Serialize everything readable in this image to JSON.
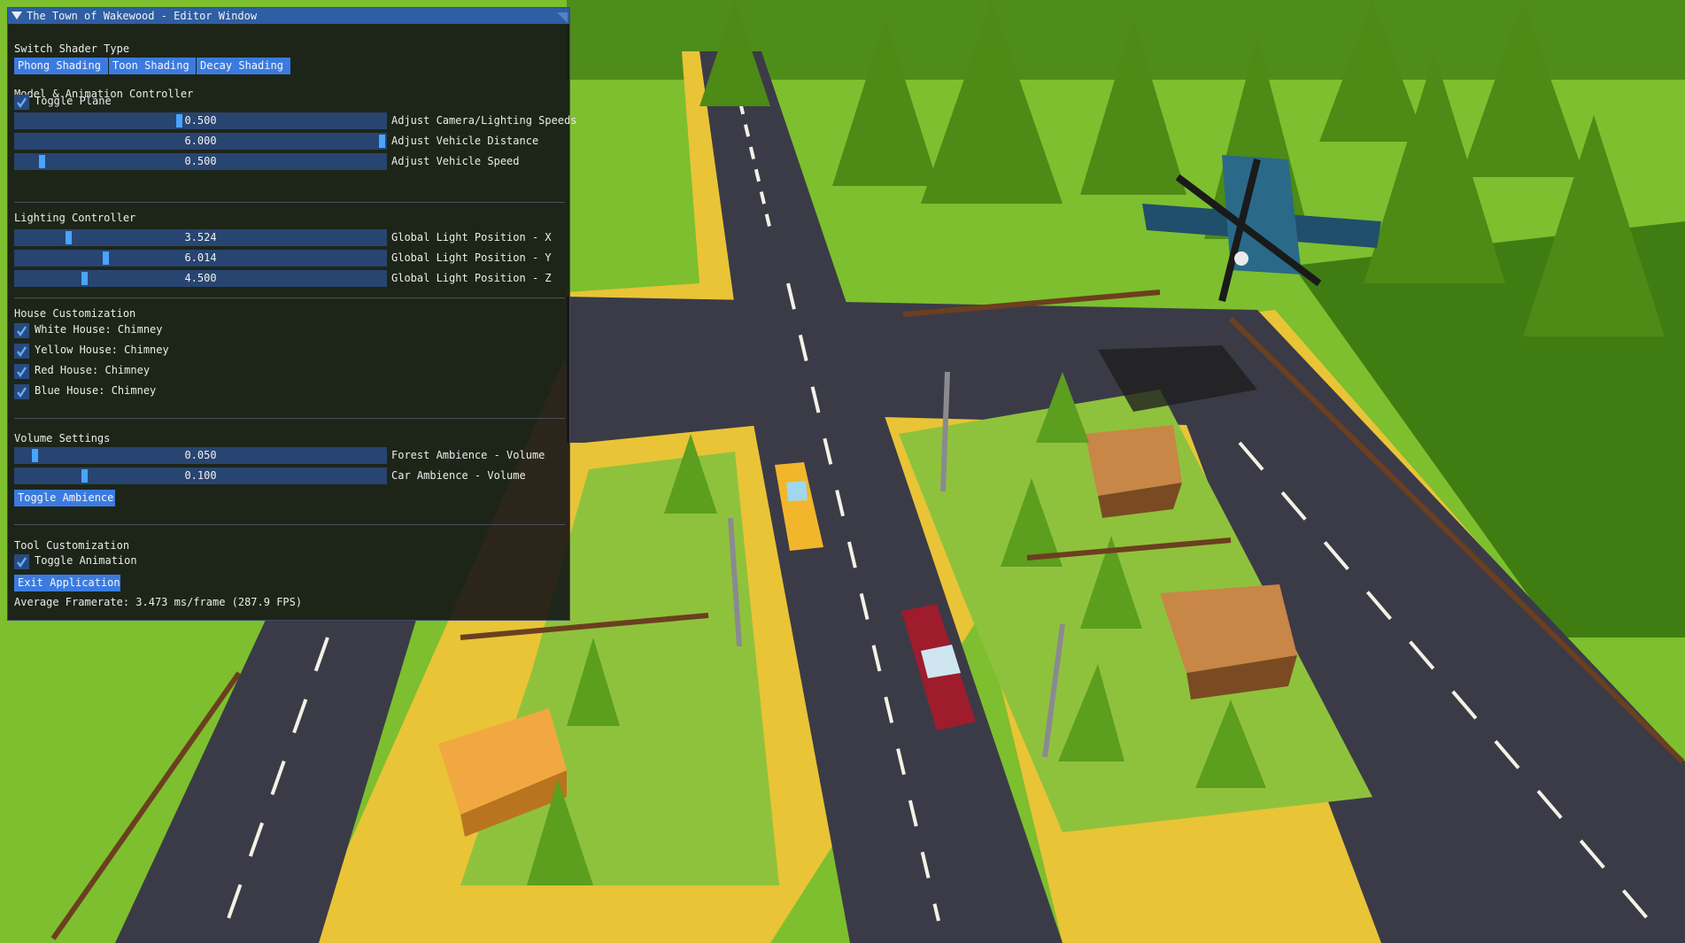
{
  "window": {
    "title": "The Town of Wakewood - Editor Window"
  },
  "shader": {
    "header": "Switch Shader Type",
    "buttons": [
      "Phong Shading",
      "Toon Shading",
      "Decay Shading"
    ]
  },
  "model": {
    "header": "Model & Animation Controller",
    "toggle_plane": {
      "label": "Toggle Plane",
      "checked": true
    },
    "sliders": [
      {
        "value": "0.500",
        "label": "Adjust Camera/Lighting Speeds",
        "fraction": 0.44
      },
      {
        "value": "6.000",
        "label": "Adjust Vehicle Distance",
        "fraction": 1.0
      },
      {
        "value": "0.500",
        "label": "Adjust Vehicle Speed",
        "fraction": 0.07
      }
    ]
  },
  "lighting": {
    "header": "Lighting Controller",
    "sliders": [
      {
        "value": "3.524",
        "label": "Global Light Position - X",
        "fraction": 0.14
      },
      {
        "value": "6.014",
        "label": "Global Light Position - Y",
        "fraction": 0.24
      },
      {
        "value": "4.500",
        "label": "Global Light Position - Z",
        "fraction": 0.18
      }
    ]
  },
  "houses": {
    "header": "House Customization",
    "items": [
      {
        "label": "White House: Chimney",
        "checked": true
      },
      {
        "label": "Yellow House: Chimney",
        "checked": true
      },
      {
        "label": "Red House: Chimney",
        "checked": true
      },
      {
        "label": "Blue House: Chimney",
        "checked": true
      }
    ]
  },
  "volume": {
    "header": "Volume Settings",
    "sliders": [
      {
        "value": "0.050",
        "label": "Forest Ambience - Volume",
        "fraction": 0.05
      },
      {
        "value": "0.100",
        "label": "Car Ambience - Volume",
        "fraction": 0.18
      }
    ],
    "toggle_button": "Toggle Ambience"
  },
  "tools": {
    "header": "Tool Customization",
    "toggle_animation": {
      "label": "Toggle Animation",
      "checked": true
    },
    "exit_button": "Exit Application",
    "framerate": "Average Framerate: 3.473 ms/frame (287.9 FPS)"
  },
  "colors": {
    "title_bar": "#2e5ea3",
    "button": "#3b7be0",
    "slider_track": "#2c4e8a",
    "slider_grab": "#49a4ff",
    "grass": "#7dbf2e",
    "road": "#3b3b47",
    "sidewalk": "#f2c531"
  },
  "icons": {
    "collapse": "triangle-down-icon",
    "check": "checkmark-icon",
    "resize": "resize-grip-icon"
  }
}
